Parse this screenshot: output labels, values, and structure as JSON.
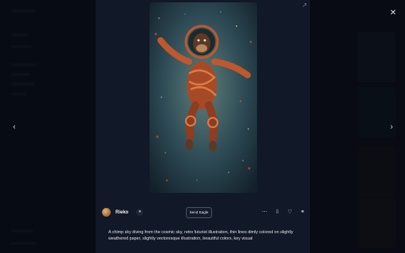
{
  "lightbox": {
    "author": {
      "name": "Rieko"
    },
    "send_button_label": "Send Eagle",
    "prompt": "A chimp sky diving from the cosmic sky, retro futurist illustration, thin lines dimly colored on slightly weathered paper, slightly vectoresque illustration, beautiful colors, key visual"
  },
  "icons": {
    "close": "close-icon",
    "prev": "chevron-left-icon",
    "next": "chevron-right-icon",
    "expand": "expand-icon",
    "tip": "tip-icon",
    "more": "more-icon",
    "download": "download-icon",
    "like": "heart-icon",
    "share": "share-icon"
  },
  "colors": {
    "panel": "#111827",
    "backdrop": "#0b0f19",
    "suit": "#c0572d",
    "space": "#2d4a55"
  }
}
